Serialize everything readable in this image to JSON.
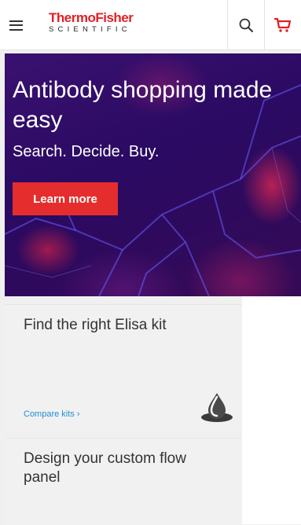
{
  "header": {
    "menu_icon": "hamburger-icon",
    "logo_brand": "ThermoFisher",
    "logo_sub": "SCIENTIFIC",
    "search_icon": "search-icon",
    "cart_icon": "cart-icon",
    "brand_color": "#e21f26"
  },
  "hero": {
    "headline": "Antibody shopping made easy",
    "tagline": "Search. Decide. Buy.",
    "cta_label": "Learn more",
    "cta_color": "#e52d2d"
  },
  "cards": [
    {
      "title": "Find the right Elisa kit",
      "link_label": "Compare kits ›",
      "icon": "drop-icon"
    },
    {
      "title": "Design your custom flow panel"
    }
  ],
  "link_color": "#1f8ed6"
}
